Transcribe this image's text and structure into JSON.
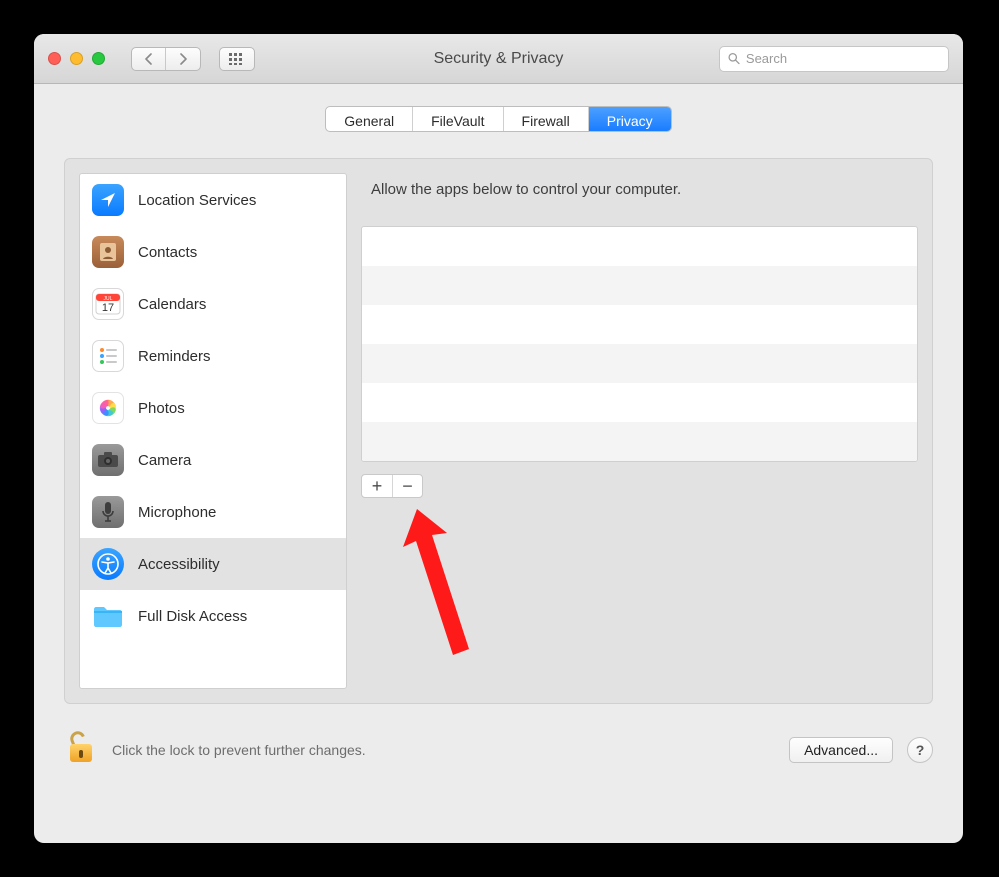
{
  "window": {
    "title": "Security & Privacy"
  },
  "search": {
    "placeholder": "Search"
  },
  "tabs": [
    {
      "label": "General",
      "active": false
    },
    {
      "label": "FileVault",
      "active": false
    },
    {
      "label": "Firewall",
      "active": false
    },
    {
      "label": "Privacy",
      "active": true
    }
  ],
  "sidebar": {
    "items": [
      {
        "label": "Location Services",
        "icon": "location"
      },
      {
        "label": "Contacts",
        "icon": "contacts"
      },
      {
        "label": "Calendars",
        "icon": "calendar"
      },
      {
        "label": "Reminders",
        "icon": "reminders"
      },
      {
        "label": "Photos",
        "icon": "photos"
      },
      {
        "label": "Camera",
        "icon": "camera"
      },
      {
        "label": "Microphone",
        "icon": "microphone"
      },
      {
        "label": "Accessibility",
        "icon": "accessibility",
        "selected": true
      },
      {
        "label": "Full Disk Access",
        "icon": "folder"
      }
    ]
  },
  "detail": {
    "description": "Allow the apps below to control your computer.",
    "add_label": "+",
    "remove_label": "−"
  },
  "footer": {
    "lock_text": "Click the lock to prevent further changes.",
    "advanced_label": "Advanced...",
    "help_label": "?"
  },
  "colors": {
    "accent": "#1a7dff"
  }
}
